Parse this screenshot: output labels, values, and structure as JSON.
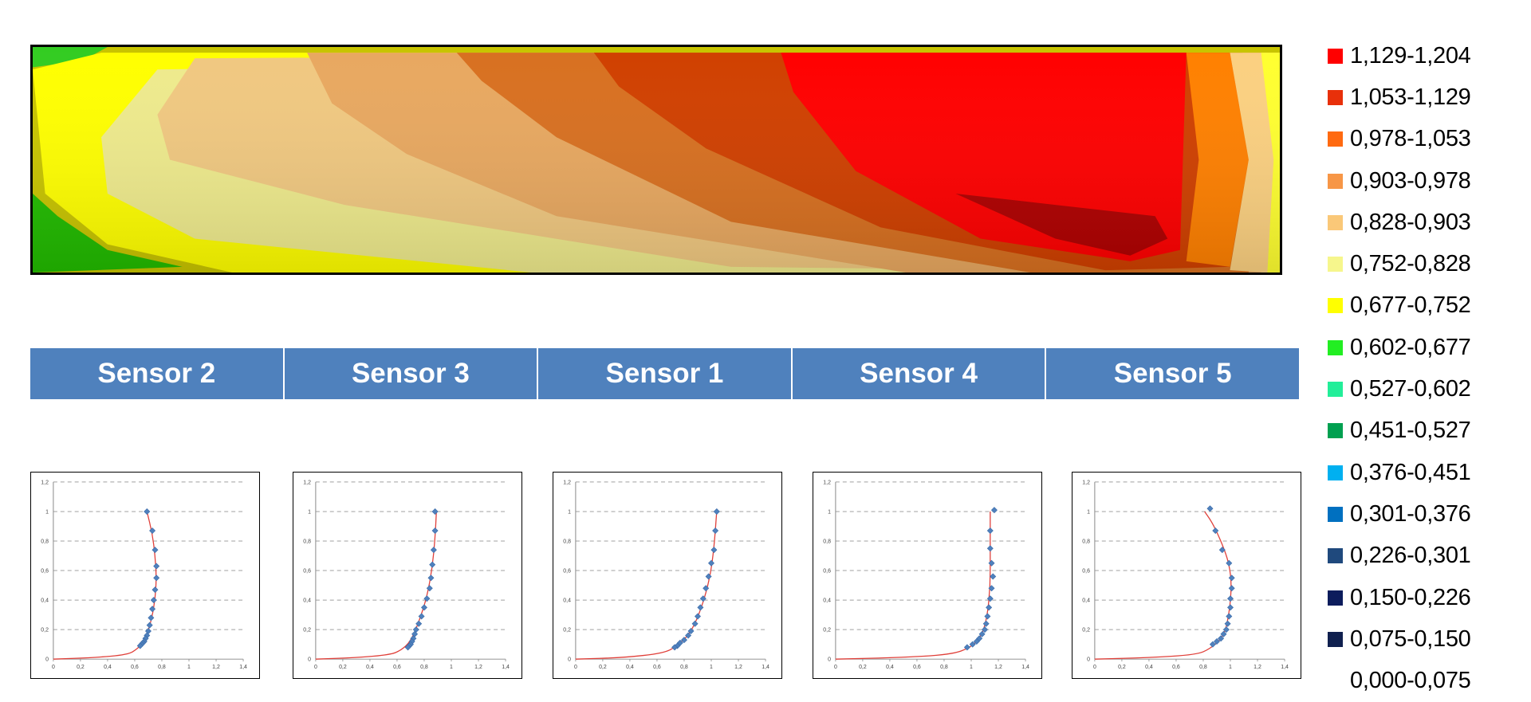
{
  "contour_map": {
    "colors": {
      "band_1129_1204": "#ff0000",
      "band_1053_1129": "#e82a00",
      "band_0978_1053": "#ff6600",
      "band_0903_0978": "#f79646",
      "band_0828_0903": "#f6cc85",
      "band_0752_0828": "#f2f28a",
      "band_0677_0752": "#ffff00",
      "band_0602_0677": "#00ee00"
    }
  },
  "sensors": {
    "headers": [
      "Sensor 2",
      "Sensor 3",
      "Sensor 1",
      "Sensor 4",
      "Sensor 5"
    ],
    "header_color": "#4f81bd"
  },
  "legend": {
    "items": [
      {
        "label": "1,129-1,204",
        "color": "#ff0000"
      },
      {
        "label": "1,053-1,129",
        "color": "#e8300a"
      },
      {
        "label": "0,978-1,053",
        "color": "#ff6a10"
      },
      {
        "label": "0,903-0,978",
        "color": "#f79646"
      },
      {
        "label": "0,828-0,903",
        "color": "#fac878"
      },
      {
        "label": "0,752-0,828",
        "color": "#f6f68c"
      },
      {
        "label": "0,677-0,752",
        "color": "#ffff00"
      },
      {
        "label": "0,602-0,677",
        "color": "#22ee22"
      },
      {
        "label": "0,527-0,602",
        "color": "#22ee99"
      },
      {
        "label": "0,451-0,527",
        "color": "#00a050"
      },
      {
        "label": "0,376-0,451",
        "color": "#00b0f0"
      },
      {
        "label": "0,301-0,376",
        "color": "#0070c0"
      },
      {
        "label": "0,226-0,301",
        "color": "#1f497d"
      },
      {
        "label": "0,150-0,226",
        "color": "#0c1c5c"
      },
      {
        "label": "0,075-0,150",
        "color": "#10204f"
      },
      {
        "label": "0,000-0,075",
        "color": "#ffffff"
      }
    ]
  },
  "chart_data": [
    {
      "type": "scatter",
      "sensor": "Sensor 2",
      "xlim": [
        0,
        1.4
      ],
      "ylim": [
        0,
        1.2
      ],
      "xticks": [
        "0",
        "0,2",
        "0,4",
        "0,6",
        "0,8",
        "1",
        "1,2",
        "1,4"
      ],
      "yticks": [
        "0",
        "0,2",
        "0,4",
        "0,6",
        "0,8",
        "1",
        "1,2"
      ],
      "points": [
        [
          0.69,
          1.0
        ],
        [
          0.73,
          0.87
        ],
        [
          0.75,
          0.74
        ],
        [
          0.76,
          0.63
        ],
        [
          0.76,
          0.55
        ],
        [
          0.75,
          0.47
        ],
        [
          0.74,
          0.4
        ],
        [
          0.73,
          0.34
        ],
        [
          0.72,
          0.28
        ],
        [
          0.71,
          0.23
        ],
        [
          0.7,
          0.19
        ],
        [
          0.69,
          0.16
        ],
        [
          0.68,
          0.14
        ],
        [
          0.67,
          0.12
        ],
        [
          0.66,
          0.11
        ],
        [
          0.65,
          0.1
        ],
        [
          0.64,
          0.09
        ]
      ],
      "fit_line": [
        [
          0.0,
          0.0
        ],
        [
          0.3,
          0.01
        ],
        [
          0.55,
          0.03
        ],
        [
          0.62,
          0.07
        ],
        [
          0.67,
          0.12
        ],
        [
          0.72,
          0.25
        ],
        [
          0.75,
          0.4
        ],
        [
          0.76,
          0.55
        ],
        [
          0.75,
          0.7
        ],
        [
          0.73,
          0.85
        ],
        [
          0.69,
          1.0
        ]
      ]
    },
    {
      "type": "scatter",
      "sensor": "Sensor 3",
      "xlim": [
        0,
        1.4
      ],
      "ylim": [
        0,
        1.2
      ],
      "xticks": [
        "0",
        "0,2",
        "0,4",
        "0,6",
        "0,8",
        "1",
        "1,2",
        "1,4"
      ],
      "yticks": [
        "0",
        "0,2",
        "0,4",
        "0,6",
        "0,8",
        "1",
        "1,2"
      ],
      "points": [
        [
          0.88,
          1.0
        ],
        [
          0.88,
          0.87
        ],
        [
          0.87,
          0.74
        ],
        [
          0.86,
          0.64
        ],
        [
          0.85,
          0.55
        ],
        [
          0.84,
          0.48
        ],
        [
          0.82,
          0.41
        ],
        [
          0.8,
          0.35
        ],
        [
          0.78,
          0.29
        ],
        [
          0.76,
          0.24
        ],
        [
          0.74,
          0.2
        ],
        [
          0.73,
          0.17
        ],
        [
          0.72,
          0.14
        ],
        [
          0.71,
          0.12
        ],
        [
          0.7,
          0.1
        ],
        [
          0.69,
          0.09
        ],
        [
          0.68,
          0.08
        ]
      ],
      "fit_line": [
        [
          0.0,
          0.0
        ],
        [
          0.3,
          0.01
        ],
        [
          0.55,
          0.03
        ],
        [
          0.63,
          0.06
        ],
        [
          0.7,
          0.12
        ],
        [
          0.76,
          0.25
        ],
        [
          0.82,
          0.42
        ],
        [
          0.86,
          0.62
        ],
        [
          0.88,
          0.82
        ],
        [
          0.89,
          1.0
        ]
      ]
    },
    {
      "type": "scatter",
      "sensor": "Sensor 1",
      "xlim": [
        0,
        1.4
      ],
      "ylim": [
        0,
        1.2
      ],
      "xticks": [
        "0",
        "0,2",
        "0,4",
        "0,6",
        "0,8",
        "1",
        "1,2",
        "1,4"
      ],
      "yticks": [
        "0",
        "0,2",
        "0,4",
        "0,6",
        "0,8",
        "1",
        "1,2"
      ],
      "points": [
        [
          1.04,
          1.0
        ],
        [
          1.03,
          0.87
        ],
        [
          1.02,
          0.74
        ],
        [
          1.0,
          0.65
        ],
        [
          0.98,
          0.56
        ],
        [
          0.96,
          0.48
        ],
        [
          0.94,
          0.41
        ],
        [
          0.92,
          0.35
        ],
        [
          0.9,
          0.29
        ],
        [
          0.88,
          0.24
        ],
        [
          0.85,
          0.19
        ],
        [
          0.83,
          0.16
        ],
        [
          0.8,
          0.13
        ],
        [
          0.77,
          0.11
        ],
        [
          0.75,
          0.09
        ],
        [
          0.73,
          0.08
        ]
      ],
      "fit_line": [
        [
          0.0,
          0.0
        ],
        [
          0.35,
          0.01
        ],
        [
          0.65,
          0.04
        ],
        [
          0.75,
          0.09
        ],
        [
          0.85,
          0.18
        ],
        [
          0.93,
          0.35
        ],
        [
          0.99,
          0.55
        ],
        [
          1.02,
          0.75
        ],
        [
          1.04,
          1.0
        ]
      ]
    },
    {
      "type": "scatter",
      "sensor": "Sensor 4",
      "xlim": [
        0,
        1.4
      ],
      "ylim": [
        0,
        1.2
      ],
      "xticks": [
        "0",
        "0,2",
        "0,4",
        "0,6",
        "0,8",
        "1",
        "1,2",
        "1,4"
      ],
      "yticks": [
        "0",
        "0,2",
        "0,4",
        "0,6",
        "0,8",
        "1",
        "1,2"
      ],
      "points": [
        [
          1.17,
          1.01
        ],
        [
          1.14,
          0.87
        ],
        [
          1.14,
          0.75
        ],
        [
          1.15,
          0.65
        ],
        [
          1.16,
          0.56
        ],
        [
          1.15,
          0.48
        ],
        [
          1.14,
          0.41
        ],
        [
          1.13,
          0.35
        ],
        [
          1.12,
          0.29
        ],
        [
          1.11,
          0.24
        ],
        [
          1.1,
          0.2
        ],
        [
          1.08,
          0.17
        ],
        [
          1.06,
          0.14
        ],
        [
          1.04,
          0.12
        ],
        [
          1.01,
          0.1
        ],
        [
          0.97,
          0.08
        ]
      ],
      "fit_line": [
        [
          0.0,
          0.0
        ],
        [
          0.45,
          0.01
        ],
        [
          0.85,
          0.03
        ],
        [
          1.0,
          0.08
        ],
        [
          1.08,
          0.16
        ],
        [
          1.12,
          0.3
        ],
        [
          1.14,
          0.5
        ],
        [
          1.14,
          0.7
        ],
        [
          1.14,
          0.9
        ],
        [
          1.14,
          1.0
        ]
      ]
    },
    {
      "type": "scatter",
      "sensor": "Sensor 5",
      "xlim": [
        0,
        1.4
      ],
      "ylim": [
        0,
        1.2
      ],
      "xticks": [
        "0",
        "0,2",
        "0,4",
        "0,6",
        "0,8",
        "1",
        "1,2",
        "1,4"
      ],
      "yticks": [
        "0",
        "0,2",
        "0,4",
        "0,6",
        "0,8",
        "1",
        "1,2"
      ],
      "points": [
        [
          0.85,
          1.02
        ],
        [
          0.89,
          0.87
        ],
        [
          0.94,
          0.74
        ],
        [
          0.99,
          0.65
        ],
        [
          1.01,
          0.55
        ],
        [
          1.01,
          0.48
        ],
        [
          1.0,
          0.41
        ],
        [
          1.0,
          0.35
        ],
        [
          0.99,
          0.29
        ],
        [
          0.98,
          0.24
        ],
        [
          0.97,
          0.2
        ],
        [
          0.95,
          0.17
        ],
        [
          0.93,
          0.14
        ],
        [
          0.9,
          0.12
        ],
        [
          0.87,
          0.1
        ]
      ],
      "fit_line": [
        [
          0.0,
          0.0
        ],
        [
          0.4,
          0.01
        ],
        [
          0.75,
          0.03
        ],
        [
          0.85,
          0.07
        ],
        [
          0.95,
          0.15
        ],
        [
          0.99,
          0.3
        ],
        [
          1.01,
          0.5
        ],
        [
          0.99,
          0.65
        ],
        [
          0.94,
          0.78
        ],
        [
          0.87,
          0.92
        ],
        [
          0.81,
          1.0
        ]
      ]
    }
  ]
}
